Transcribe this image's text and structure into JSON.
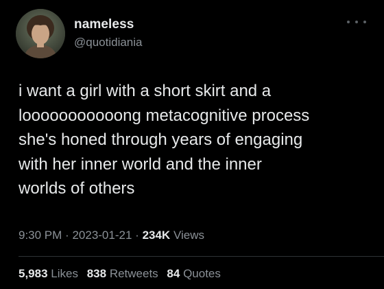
{
  "author": {
    "display_name": "nameless",
    "handle": "@quotidiania"
  },
  "tweet": {
    "text": "i want a girl with a short skirt and a\nlooooooooooong metacognitive process\nshe's honed through years of engaging\nwith her inner world and the inner\nworlds of others"
  },
  "meta": {
    "time": "9:30 PM",
    "separator": "·",
    "date": "2023-01-21",
    "views_count": "234K",
    "views_label": "Views"
  },
  "stats": {
    "likes_count": "5,983",
    "likes_label": "Likes",
    "retweets_count": "838",
    "retweets_label": "Retweets",
    "quotes_count": "84",
    "quotes_label": "Quotes"
  },
  "icons": {
    "more": "more-horizontal-icon"
  },
  "colors": {
    "background": "#000000",
    "primary_text": "#e7e9ea",
    "secondary_text": "#8b9197",
    "divider": "#2f3336"
  }
}
